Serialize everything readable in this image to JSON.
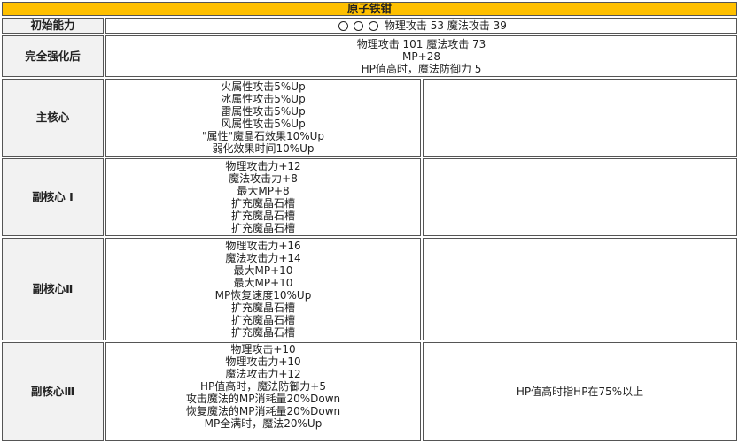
{
  "title": "原子铁钳",
  "initial": {
    "label": "初始能力",
    "slots": [
      "empty-slot",
      "empty-slot",
      "empty-slot"
    ],
    "text": "物理攻击 53 魔法攻击 39"
  },
  "full_upgrade": {
    "label": "完全强化后",
    "lines": [
      "物理攻击 101 魔法攻击 73",
      "MP+28",
      "HP值高时，魔法防御力 5"
    ]
  },
  "cores": [
    {
      "label": "主核心",
      "lines": [
        "火属性攻击5%Up",
        "冰属性攻击5%Up",
        "雷属性攻击5%Up",
        "风属性攻击5%Up",
        "\"属性\"魔晶石效果10%Up",
        "弱化效果时间10%Up"
      ],
      "note": ""
    },
    {
      "label": "副核心 Ⅰ",
      "lines": [
        "物理攻击力+12",
        "魔法攻击力+8",
        "最大MP+8",
        "扩充魔晶石槽",
        "扩充魔晶石槽",
        "扩充魔晶石槽"
      ],
      "note": ""
    },
    {
      "label": "副核心Ⅱ",
      "lines": [
        "物理攻击力+16",
        "魔法攻击力+14",
        "最大MP+10",
        "最大MP+10",
        "MP恢复速度10%Up",
        "扩充魔晶石槽",
        "扩充魔晶石槽",
        "扩充魔晶石槽"
      ],
      "note": ""
    },
    {
      "label": "副核心Ⅲ",
      "lines": [
        "物理攻击+10",
        "物理攻击力+10",
        "魔法攻击力+12",
        "HP值高时，魔法防御力+5",
        "攻击魔法的MP消耗量20%Down",
        "恢复魔法的MP消耗量20%Down",
        "MP全满时，魔法20%Up"
      ],
      "note": "HP值高时指HP在75%以上"
    }
  ]
}
